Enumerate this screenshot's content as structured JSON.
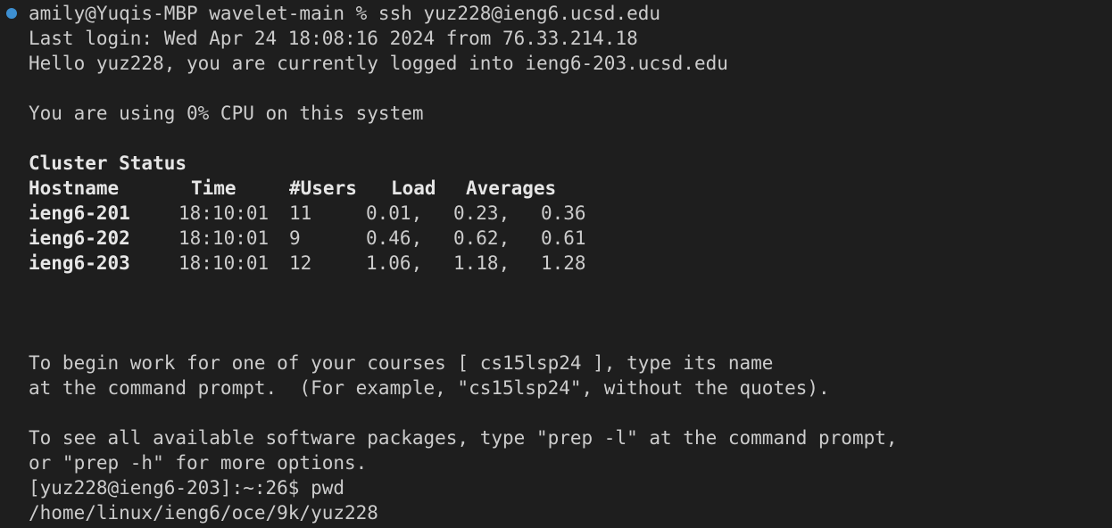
{
  "colors": {
    "background": "#1e1e1e",
    "text": "#cccccc",
    "status_dot": "#3d8fd1"
  },
  "terminal": {
    "prompt_line": "amily@Yuqis-MBP wavelet-main % ssh yuz228@ieng6.ucsd.edu",
    "last_login": "Last login: Wed Apr 24 18:08:16 2024 from 76.33.214.18",
    "hello": "Hello yuz228, you are currently logged into ieng6-203.ucsd.edu",
    "cpu": "You are using 0% CPU on this system",
    "cluster_title": "Cluster Status",
    "cluster_headers": {
      "hostname": "Hostname",
      "time": "Time",
      "users": "#Users",
      "load": "Load",
      "averages": "Averages"
    },
    "cluster_rows": [
      {
        "host": "ieng6-201",
        "time": "18:10:01",
        "users": "11",
        "load1": "0.01,",
        "load5": "0.23,",
        "load15": "0.36"
      },
      {
        "host": "ieng6-202",
        "time": "18:10:01",
        "users": "9",
        "load1": "0.46,",
        "load5": "0.62,",
        "load15": "0.61"
      },
      {
        "host": "ieng6-203",
        "time": "18:10:01",
        "users": "12",
        "load1": "1.06,",
        "load5": "1.18,",
        "load15": "1.28"
      }
    ],
    "courses_line1": "To begin work for one of your courses [ cs15lsp24 ], type its name",
    "courses_line2": "at the command prompt.  (For example, \"cs15lsp24\", without the quotes).",
    "packages_line1": "To see all available software packages, type \"prep -l\" at the command prompt,",
    "packages_line2": "or \"prep -h\" for more options.",
    "remote_prompt": "[yuz228@ieng6-203]:~:26$ pwd",
    "pwd_output": "/home/linux/ieng6/oce/9k/yuz228"
  }
}
